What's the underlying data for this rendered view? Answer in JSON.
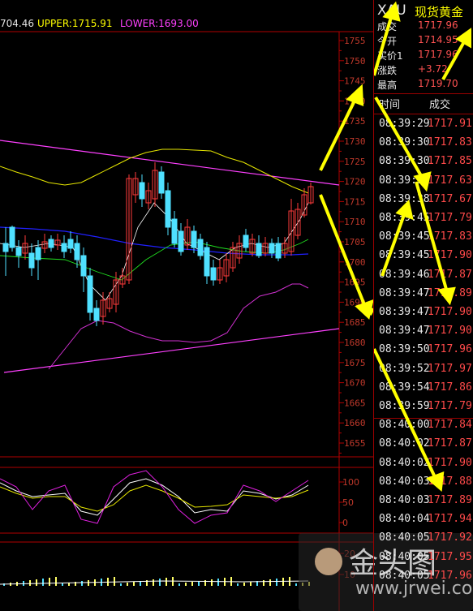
{
  "bollinger_bar": {
    "mid_value": "704.46",
    "upper_label": "UPPER:1715.91",
    "lower_label": "LOWER:1693.00"
  },
  "price_axis": {
    "ticks": [
      "1755",
      "1750",
      "1745",
      "1740",
      "1735",
      "1730",
      "1725",
      "1720",
      "1715",
      "1710",
      "1705",
      "1700",
      "1695",
      "1690",
      "1685",
      "1680",
      "1675",
      "1670",
      "1665",
      "1660",
      "1655"
    ]
  },
  "osc_axis": {
    "ticks": [
      "100",
      "50",
      "0"
    ]
  },
  "volume_axis": {
    "ticks": [
      "20",
      "10"
    ]
  },
  "quote": {
    "symbol": "XAU",
    "name": "现货黄金",
    "rows": [
      {
        "label": "成交",
        "value": "1717.96"
      },
      {
        "label": "今开",
        "value": "1714.95"
      },
      {
        "label": "买价1",
        "value": "1717.96"
      },
      {
        "label": "涨跌",
        "value": "+3.72"
      },
      {
        "label": "最高",
        "value": "1719.70"
      }
    ]
  },
  "ticks_table": {
    "header_time": "时间",
    "header_price": "成交",
    "rows": [
      {
        "time": "08:39:29",
        "price": "1717.91"
      },
      {
        "time": "08:39:30",
        "price": "1717.83"
      },
      {
        "time": "08:39:30",
        "price": "1717.85"
      },
      {
        "time": "08:39:35",
        "price": "1717.63"
      },
      {
        "time": "08:39:38",
        "price": "1717.67"
      },
      {
        "time": "08:39:45",
        "price": "1717.79"
      },
      {
        "time": "08:39:45",
        "price": "1717.83"
      },
      {
        "time": "08:39:45",
        "price": "1717.90"
      },
      {
        "time": "08:39:46",
        "price": "1717.87"
      },
      {
        "time": "08:39:47",
        "price": "1717.89"
      },
      {
        "time": "08:39:47",
        "price": "1717.90"
      },
      {
        "time": "08:39:47",
        "price": "1717.90"
      },
      {
        "time": "08:39:50",
        "price": "1717.96"
      },
      {
        "time": "08:39:52",
        "price": "1717.97"
      },
      {
        "time": "08:39:54",
        "price": "1717.86"
      },
      {
        "time": "08:39:59",
        "price": "1717.79"
      },
      {
        "time": "08:40:00",
        "price": "1717.84"
      },
      {
        "time": "08:40:02",
        "price": "1717.87"
      },
      {
        "time": "08:40:02",
        "price": "1717.90"
      },
      {
        "time": "08:40:03",
        "price": "1717.88"
      },
      {
        "time": "08:40:03",
        "price": "1717.89"
      },
      {
        "time": "08:40:04",
        "price": "1717.94"
      },
      {
        "time": "08:40:05",
        "price": "1717.92"
      },
      {
        "time": "08:40:05",
        "price": "1717.95"
      },
      {
        "time": "08:40:05",
        "price": "1717.96"
      }
    ]
  },
  "watermark": {
    "brand": "金头图",
    "url": "www.jrwei.com"
  },
  "colors": {
    "background": "#000000",
    "grid_border": "#b00000",
    "bull_candle": "#ff3b3b",
    "bear_candle": "#4fe0ff",
    "upper_text": "#ffff00",
    "lower_text": "#ff40ff",
    "annotation_arrow": "#ffff00"
  }
}
